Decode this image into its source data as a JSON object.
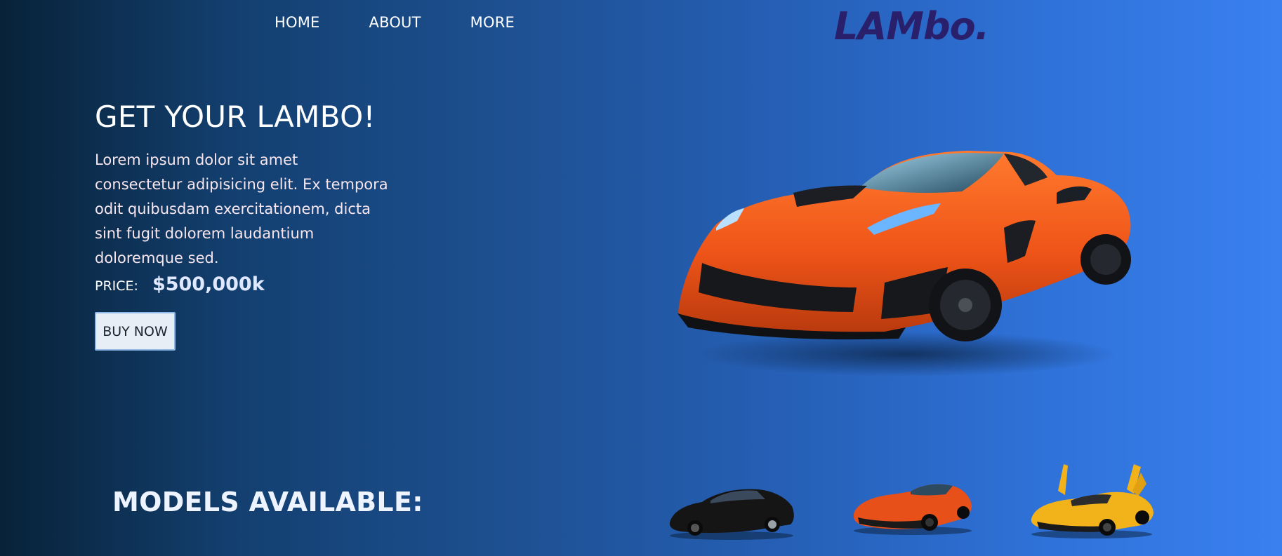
{
  "nav": {
    "items": [
      {
        "label": "HOME"
      },
      {
        "label": "ABOUT"
      },
      {
        "label": "MORE"
      }
    ]
  },
  "brand": {
    "logo": "LAMbo."
  },
  "hero": {
    "title": "GET YOUR LAMBO!",
    "description": "Lorem ipsum dolor sit amet consectetur adipisicing elit. Ex tempora odit quibusdam exercitationem, dicta sint fugit dolorem laudantium doloremque sed.",
    "price_label": "PRICE:",
    "price_value": "$500,000k",
    "buy_button": "BUY NOW"
  },
  "models": {
    "title": "MODELS AVAILABLE:",
    "items": [
      {
        "icon": "black-sports-car-icon",
        "color": "#151515"
      },
      {
        "icon": "orange-sports-car-icon",
        "color": "#e8501a"
      },
      {
        "icon": "yellow-supercar-icon",
        "color": "#f2b21a"
      }
    ]
  },
  "colors": {
    "logo": "#2a1f6b",
    "button_bg": "#e7eef6",
    "hero_car": "#ef5a1c"
  }
}
